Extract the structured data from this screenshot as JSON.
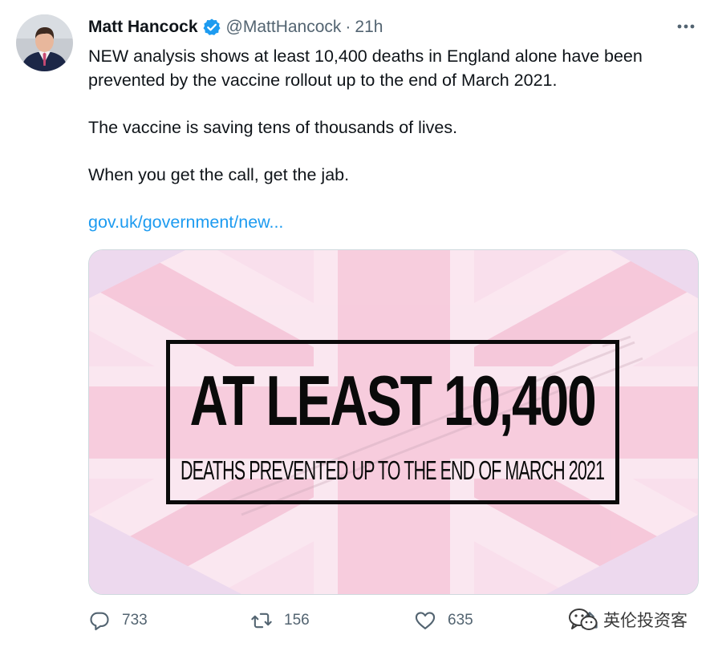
{
  "author": {
    "name": "Matt Hancock",
    "handle": "@MattHancock",
    "separator": "·",
    "time": "21h"
  },
  "tweet": {
    "para1": "NEW analysis shows at least 10,400 deaths in England alone have been prevented by the vaccine rollout up to the end of March 2021.",
    "para2": "The vaccine is saving tens of thousands of lives.",
    "para3": "When you get the call, get the jab.",
    "link": "gov.uk/government/new..."
  },
  "media": {
    "headline": "AT LEAST 10,400",
    "subline": "DEATHS PREVENTED UP TO THE END OF MARCH 2021"
  },
  "actions": {
    "replies": "733",
    "retweets": "156",
    "likes": "635"
  },
  "watermark": {
    "text": "英伦投资客"
  },
  "colors": {
    "link": "#1d9bf0",
    "verified": "#1d9bf0",
    "muted": "#536471",
    "media_bg": "#f8dcea"
  },
  "icons": {
    "more": "more-horizontal-icon",
    "verified": "verified-badge-icon",
    "reply": "reply-icon",
    "retweet": "retweet-icon",
    "like": "heart-icon",
    "share": "share-icon",
    "watermark": "wechat-icon"
  }
}
